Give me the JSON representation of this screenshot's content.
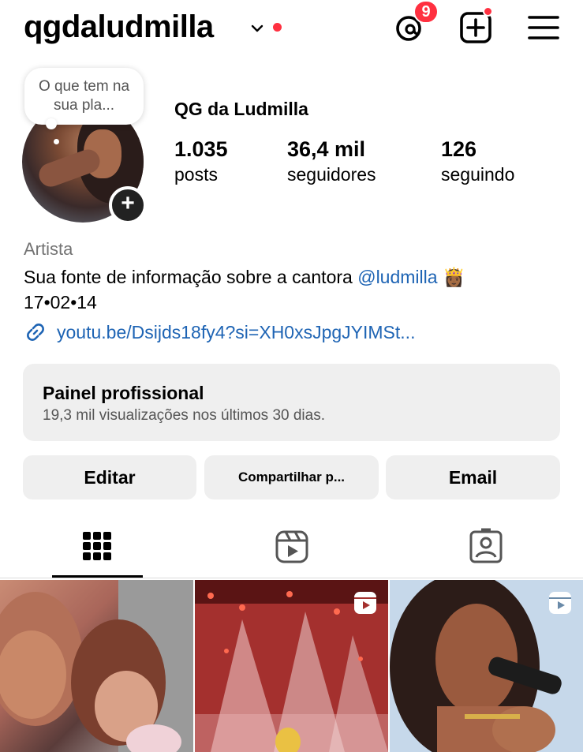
{
  "header": {
    "username": "qgdaludmilla",
    "threads_badge": "9"
  },
  "note": {
    "text": "O que tem na sua pla..."
  },
  "profile": {
    "display_name": "QG da Ludmilla",
    "stats": [
      {
        "value": "1.035",
        "label": "posts"
      },
      {
        "value": "36,4 mil",
        "label": "seguidores"
      },
      {
        "value": "126",
        "label": "seguindo"
      }
    ],
    "category": "Artista",
    "bio_text": "Sua fonte de informação sobre a cantora ",
    "bio_mention": "@ludmilla",
    "bio_emoji": "👸🏾",
    "bio_date": "17•02•14",
    "link": "youtu.be/Dsijds18fy4?si=XH0xsJpgJYIMSt..."
  },
  "pro_panel": {
    "title": "Painel profissional",
    "subtitle": "19,3 mil visualizações nos últimos 30 dias."
  },
  "buttons": {
    "edit": "Editar",
    "share": "Compartilhar p...",
    "email": "Email"
  },
  "tabs": [
    "grid-icon",
    "reels-icon",
    "tagged-icon"
  ],
  "colors": {
    "accent_blue": "#1e64b4",
    "notification_red": "#ff3040",
    "button_bg": "#efefef"
  }
}
